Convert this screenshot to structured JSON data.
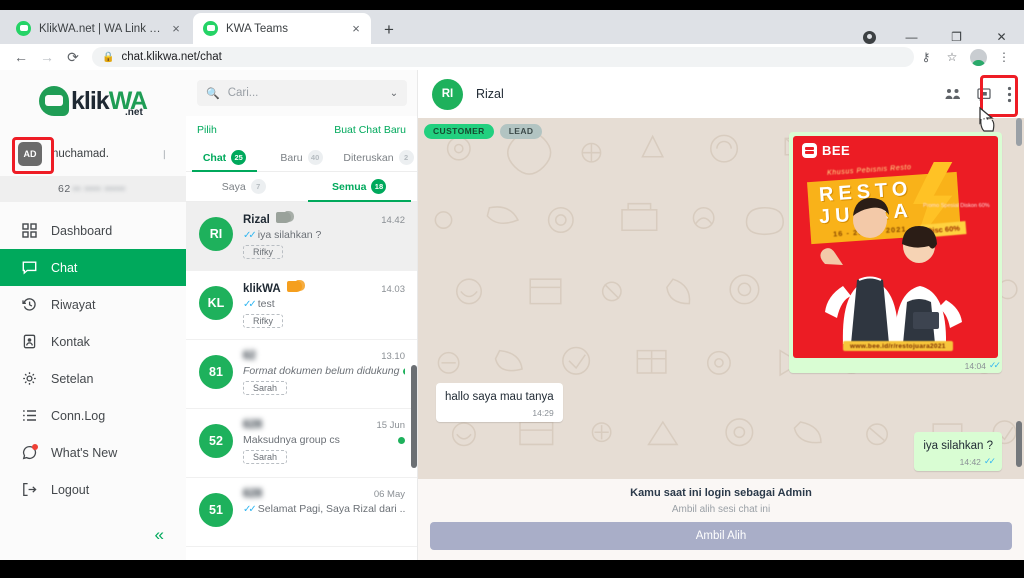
{
  "browser": {
    "tabs": [
      {
        "title": "KlikWA.net | WA Link Rotator",
        "active": false,
        "close": "×",
        "favicon": "whatsapp-favicon"
      },
      {
        "title": "KWA Teams",
        "active": true,
        "close": "×",
        "favicon": "whatsapp-favicon"
      }
    ],
    "new_tab_label": "+",
    "window_controls": {
      "minimize": "—",
      "maximize": "❐",
      "close": "✕"
    },
    "nav": {
      "back": "←",
      "forward": "→",
      "reload": "⟳"
    },
    "address": {
      "lock": "🔒",
      "url": "chat.klikwa.net/chat"
    },
    "omni_actions": {
      "key": "⚷",
      "star": "☆",
      "menu": "⋮"
    }
  },
  "sidebar": {
    "brand": {
      "k": "klik",
      "wa": "WA",
      "net": ".net"
    },
    "user": {
      "initials": "AD",
      "name": "nuchamad.",
      "caret": "❘",
      "phone_prefix": "62",
      "phone_masked": "•• •••• •••••"
    },
    "items": [
      {
        "label": "Dashboard",
        "icon": "grid-icon",
        "active": false
      },
      {
        "label": "Chat",
        "icon": "chat-bubble-icon",
        "active": true
      },
      {
        "label": "Riwayat",
        "icon": "history-clock-icon",
        "active": false
      },
      {
        "label": "Kontak",
        "icon": "contact-card-icon",
        "active": false
      },
      {
        "label": "Setelan",
        "icon": "gear-icon",
        "active": false
      },
      {
        "label": "Conn.Log",
        "icon": "list-icon",
        "active": false
      },
      {
        "label": "What's New",
        "icon": "whatsapp-icon",
        "active": false,
        "dot": true
      },
      {
        "label": "Logout",
        "icon": "logout-arrow-icon",
        "active": false
      }
    ],
    "collapse": "«"
  },
  "list_panel": {
    "search": {
      "icon": "search-icon",
      "value": "",
      "placeholder": "Cari...",
      "caret": "⌄"
    },
    "actions": {
      "select": "Pilih",
      "new_chat": "Buat Chat Baru"
    },
    "tabs_primary": [
      {
        "label": "Chat",
        "badge": "25",
        "selected": true
      },
      {
        "label": "Baru",
        "badge": "40",
        "selected": false
      },
      {
        "label": "Diteruskan",
        "badge": "2",
        "selected": false
      }
    ],
    "tabs_secondary": [
      {
        "label": "Saya",
        "badge": "7",
        "selected": false
      },
      {
        "label": "Semua",
        "badge": "18",
        "selected": true
      }
    ],
    "chats": [
      {
        "initials": "RI",
        "name": "Rizal",
        "name_blurred": false,
        "tag": "grey",
        "time": "14.42",
        "ticks": "✓✓",
        "message": "iya silahkan ?",
        "italic": false,
        "unread": false,
        "assignee": "Rifky",
        "selected": true
      },
      {
        "initials": "KL",
        "name": "klikWA",
        "name_blurred": false,
        "tag": "orange",
        "time": "14.03",
        "ticks": "✓✓",
        "message": "test",
        "italic": false,
        "unread": false,
        "assignee": "Rifky",
        "selected": false
      },
      {
        "initials": "81",
        "name": "62",
        "name_blurred": true,
        "tag": "none",
        "time": "13.10",
        "ticks": "",
        "message": "Format dokumen belum didukung",
        "italic": true,
        "unread": true,
        "assignee": "Sarah",
        "selected": false
      },
      {
        "initials": "52",
        "name": "628",
        "name_blurred": true,
        "tag": "none",
        "time": "15 Jun",
        "ticks": "",
        "message": "Maksudnya group cs",
        "italic": false,
        "unread": true,
        "assignee": "Sarah",
        "selected": false
      },
      {
        "initials": "51",
        "name": "628",
        "name_blurred": true,
        "tag": "none",
        "time": "06 May",
        "ticks": "✓✓",
        "message": "Selamat Pagi, Saya Rizal dari ...",
        "italic": false,
        "unread": false,
        "assignee": "",
        "selected": false
      }
    ]
  },
  "conversation": {
    "header": {
      "initials": "RI",
      "name": "Rizal",
      "icons": [
        {
          "name": "group-members-icon"
        },
        {
          "name": "note-flag-icon"
        },
        {
          "name": "kebab-menu-icon"
        }
      ]
    },
    "chips": [
      {
        "label": "CUSTOMER",
        "kind": "cust"
      },
      {
        "label": "LEAD",
        "kind": "lead"
      }
    ],
    "messages": [
      {
        "kind": "image",
        "direction": "out",
        "time": "14:04",
        "ticks": "✓✓",
        "promo": {
          "brand": "BEE",
          "khusus": "Khusus Pebisnis Resto",
          "title_line1": "RESTO",
          "title_line2": "JUARA",
          "date": "16 - 25 Jun 2021",
          "discount": "Disc 60%",
          "notes": "Promo Spesial\nDiskon 60%",
          "url": "www.bee.id/r/restojuara2021"
        }
      },
      {
        "kind": "text",
        "direction": "in",
        "text": "hallo saya mau tanya",
        "time": "14:29",
        "ticks": ""
      },
      {
        "kind": "text",
        "direction": "out",
        "text": "iya silahkan ?",
        "time": "14:42",
        "ticks": "✓✓"
      }
    ],
    "takeover": {
      "title": "Kamu saat ini login sebagai Admin",
      "subtitle": "Ambil alih sesi chat ini",
      "button": "Ambil Alih"
    }
  },
  "highlights": [
    {
      "name": "user-avatar-highlight",
      "color": "#ee1c25"
    },
    {
      "name": "kebab-menu-highlight",
      "color": "#ee1c25"
    }
  ]
}
